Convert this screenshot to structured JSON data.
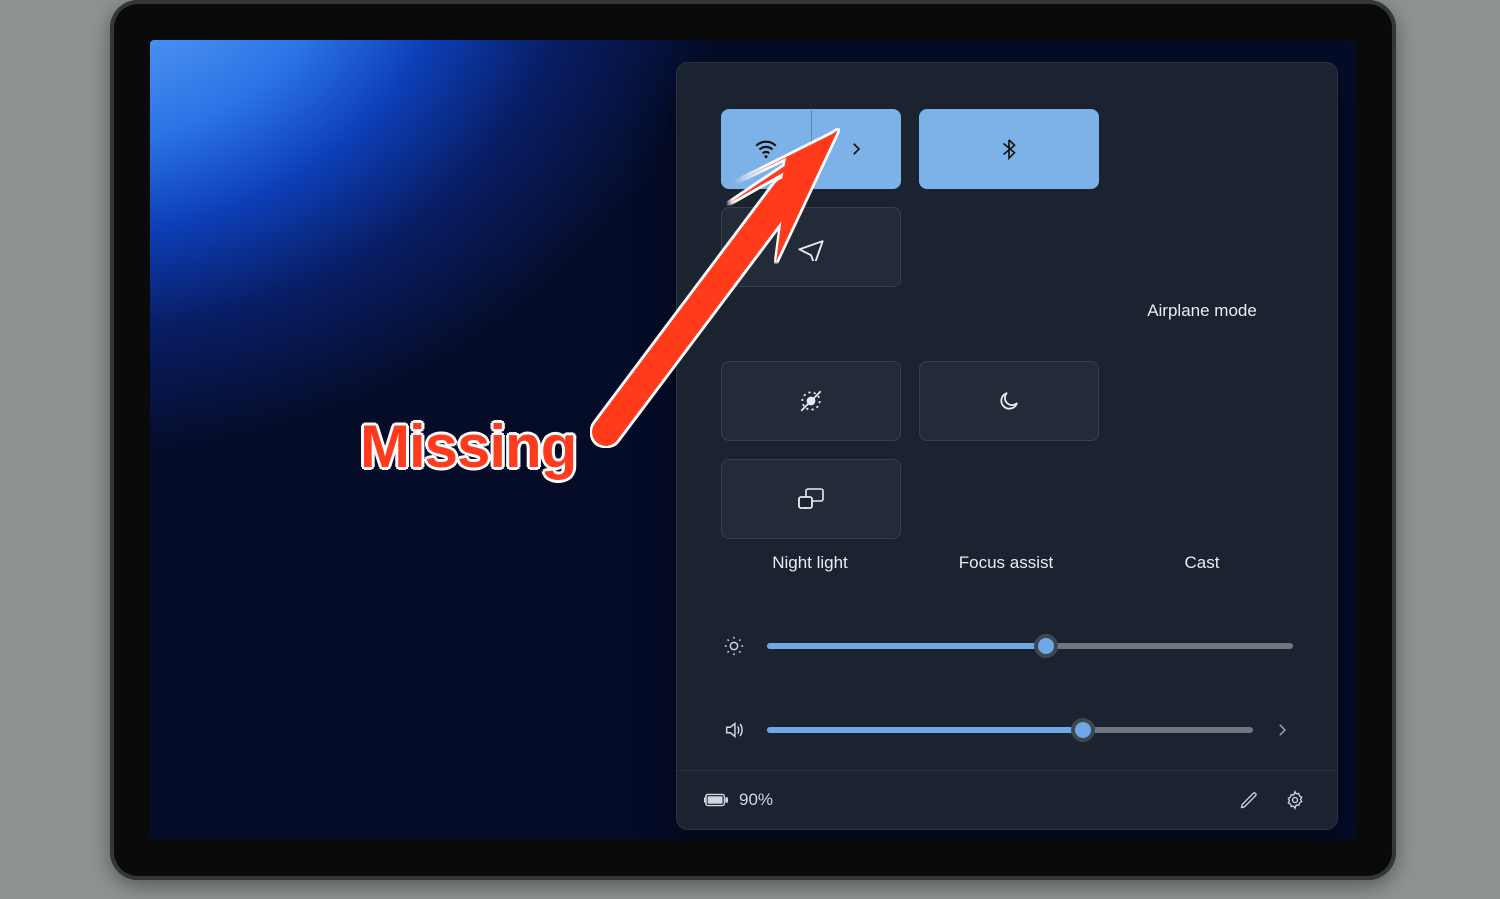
{
  "annotation": {
    "label": "Missing"
  },
  "quick_settings": {
    "tiles": [
      {
        "id": "wifi",
        "label": "",
        "active": true,
        "split": true
      },
      {
        "id": "bluetooth",
        "label": "",
        "active": true,
        "split": false
      },
      {
        "id": "airplane",
        "label": "Airplane mode",
        "active": false,
        "split": false
      },
      {
        "id": "nightlight",
        "label": "Night light",
        "active": false,
        "split": false
      },
      {
        "id": "focus",
        "label": "Focus assist",
        "active": false,
        "split": false
      },
      {
        "id": "cast",
        "label": "Cast",
        "active": false,
        "split": false
      }
    ],
    "sliders": {
      "brightness": {
        "value": 53
      },
      "volume": {
        "value": 65
      }
    },
    "battery": {
      "text": "90%"
    }
  }
}
